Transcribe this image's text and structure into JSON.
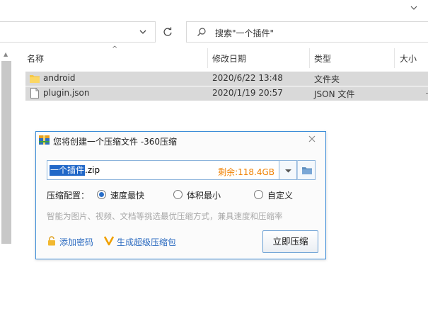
{
  "search": {
    "placeholder": "搜索\"一个插件\""
  },
  "columns": {
    "name": "名称",
    "modified": "修改日期",
    "type": "类型",
    "size": "大小"
  },
  "files": [
    {
      "name": "android",
      "modified": "2020/6/22 13:48",
      "type": "文件夹",
      "icon": "folder-icon"
    },
    {
      "name": "plugin.json",
      "modified": "2020/1/19 20:57",
      "type": "JSON 文件",
      "icon": "document-icon"
    }
  ],
  "dialog": {
    "title": "您将创建一个压缩文件 -360压缩",
    "filename_selected": "一个插件",
    "filename_ext": ".zip",
    "remaining": "剩余:118.4GB",
    "config_label": "压缩配置：",
    "options": [
      {
        "label": "速度最快",
        "selected": true
      },
      {
        "label": "体积最小",
        "selected": false
      },
      {
        "label": "自定义",
        "selected": false
      }
    ],
    "hint": "智能为图片、视频、文档等挑选最优压缩方式，兼具速度和压缩率",
    "add_password": "添加密码",
    "super_zip": "生成超级压缩包",
    "compress_button": "立即压缩"
  },
  "colors": {
    "accent": "#2168c8",
    "link": "#2c6bc0",
    "remaining": "#f08000",
    "row_selected": "#d9d9d9"
  }
}
